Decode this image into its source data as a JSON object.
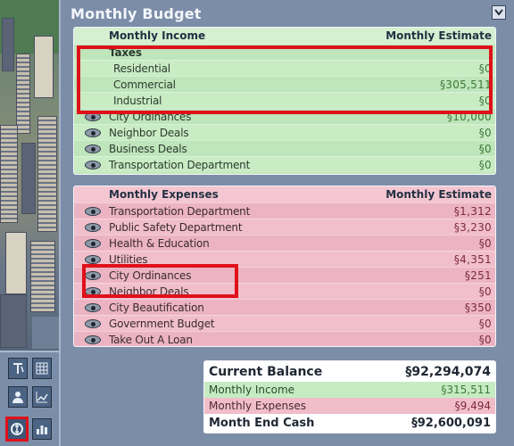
{
  "panel": {
    "title": "Monthly Budget"
  },
  "income": {
    "header": {
      "label": "Monthly Income",
      "estimate": "Monthly Estimate"
    },
    "rows": [
      {
        "label": "Taxes",
        "value": "",
        "eye": false,
        "indent": 0
      },
      {
        "label": "Residential",
        "value": "§0",
        "eye": false,
        "indent": 1
      },
      {
        "label": "Commercial",
        "value": "§305,511",
        "eye": false,
        "indent": 1
      },
      {
        "label": "Industrial",
        "value": "§0",
        "eye": false,
        "indent": 1
      },
      {
        "label": "City Ordinances",
        "value": "§10,000",
        "eye": true,
        "indent": 0
      },
      {
        "label": "Neighbor Deals",
        "value": "§0",
        "eye": true,
        "indent": 0
      },
      {
        "label": "Business Deals",
        "value": "§0",
        "eye": true,
        "indent": 0
      },
      {
        "label": "Transportation Department",
        "value": "§0",
        "eye": true,
        "indent": 0
      }
    ]
  },
  "expenses": {
    "header": {
      "label": "Monthly Expenses",
      "estimate": "Monthly Estimate"
    },
    "rows": [
      {
        "label": "Transportation Department",
        "value": "§1,312"
      },
      {
        "label": "Public Safety Department",
        "value": "§3,230"
      },
      {
        "label": "Health & Education",
        "value": "§0"
      },
      {
        "label": "Utilities",
        "value": "§4,351"
      },
      {
        "label": "City Ordinances",
        "value": "§251"
      },
      {
        "label": "Neighbor Deals",
        "value": "§0"
      },
      {
        "label": "City Beautification",
        "value": "§350"
      },
      {
        "label": "Government Budget",
        "value": "§0"
      },
      {
        "label": "Take Out A Loan",
        "value": "§0"
      }
    ]
  },
  "totals": {
    "current_balance_label": "Current Balance",
    "current_balance": "§92,294,074",
    "monthly_income_label": "Monthly Income",
    "monthly_income": "§315,511",
    "monthly_expenses_label": "Monthly Expenses",
    "monthly_expenses": "§9,494",
    "month_end_label": "Month End Cash",
    "month_end": "§92,600,091"
  },
  "colors": {
    "highlight": "#e0101a",
    "income_bg": "#c3e6bf",
    "expense_bg": "#efb9c6",
    "panel_bg": "#7c8da8"
  },
  "tools": {
    "icons": [
      "demolish-icon",
      "zone-grid-icon",
      "advisor-icon",
      "graph-icon",
      "budget-icon",
      "chart-icon"
    ]
  }
}
